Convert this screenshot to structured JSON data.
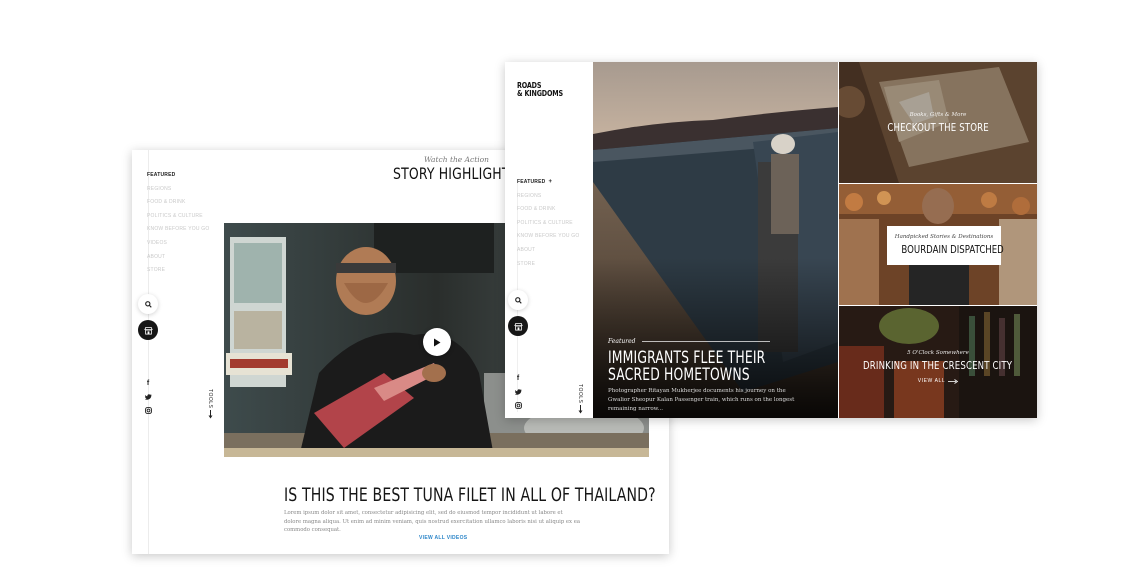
{
  "back_page": {
    "nav_items": [
      "Featured",
      "Regions",
      "Food & Drink",
      "Politics & Culture",
      "Know Before You Go",
      "Videos",
      "About",
      "Store"
    ],
    "active_nav": "Featured",
    "kicker": "Watch the Action",
    "title": "STORY HIGHLIGHTS",
    "headline": "IS THIS THE BEST TUNA FILET IN ALL OF THAILAND?",
    "body": "Lorem ipsum dolor sit amet, consectetur adipisicing elit, sed do eiusmod tempor incididunt ut labore et dolore magna aliqua. Ut enim ad minim veniam, quis nostrud exercitation ullamco laboris nisi ut aliquip ex ea commodo consequat.",
    "link": "VIEW ALL VIDEOS",
    "tools_label": "TOOLS",
    "icons": [
      "search-icon",
      "store-icon",
      "facebook-icon",
      "twitter-icon",
      "instagram-icon",
      "play-icon",
      "arrow-down-icon"
    ]
  },
  "front_page": {
    "logo_line1": "ROADS",
    "logo_line2": "& KINGDOMS",
    "nav_items": [
      "Featured",
      "Regions",
      "Food & Drink",
      "Politics & Culture",
      "Know Before You Go",
      "About",
      "Store"
    ],
    "active_nav": "Featured",
    "tools_label": "TOOLS",
    "featured": {
      "kicker": "Featured",
      "headline_line1": "IMMIGRANTS FLEE THEIR",
      "headline_line2": "SACRED HOMETOWNS",
      "description": "Photographer Ritayan Mukherjee documents his journey on the Gwalior Sheopur Kalan Passenger train, which runs on the longest remaining narrow..."
    },
    "tiles": [
      {
        "kicker": "Books, Gifts & More",
        "headline": "CHECKOUT THE STORE"
      },
      {
        "kicker": "Handpicked Stories & Destinations",
        "headline": "BOURDAIN DISPATCHED"
      },
      {
        "kicker": "5 O'Clock Somewhere",
        "headline": "DRINKING IN THE CRESCENT CITY",
        "link": "VIEW ALL"
      }
    ]
  },
  "colors": {
    "link_blue": "#2d86c9",
    "dark_button": "#161616"
  }
}
